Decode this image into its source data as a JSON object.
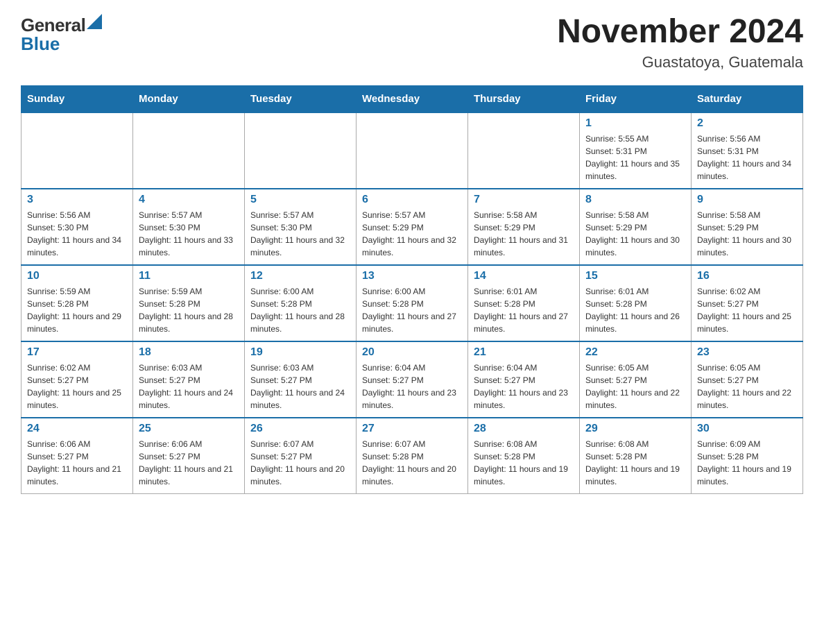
{
  "logo": {
    "general": "General",
    "blue": "Blue",
    "triangle": "▲"
  },
  "header": {
    "title": "November 2024",
    "subtitle": "Guastatoya, Guatemala"
  },
  "weekdays": [
    "Sunday",
    "Monday",
    "Tuesday",
    "Wednesday",
    "Thursday",
    "Friday",
    "Saturday"
  ],
  "weeks": [
    [
      {
        "day": "",
        "sunrise": "",
        "sunset": "",
        "daylight": ""
      },
      {
        "day": "",
        "sunrise": "",
        "sunset": "",
        "daylight": ""
      },
      {
        "day": "",
        "sunrise": "",
        "sunset": "",
        "daylight": ""
      },
      {
        "day": "",
        "sunrise": "",
        "sunset": "",
        "daylight": ""
      },
      {
        "day": "",
        "sunrise": "",
        "sunset": "",
        "daylight": ""
      },
      {
        "day": "1",
        "sunrise": "Sunrise: 5:55 AM",
        "sunset": "Sunset: 5:31 PM",
        "daylight": "Daylight: 11 hours and 35 minutes."
      },
      {
        "day": "2",
        "sunrise": "Sunrise: 5:56 AM",
        "sunset": "Sunset: 5:31 PM",
        "daylight": "Daylight: 11 hours and 34 minutes."
      }
    ],
    [
      {
        "day": "3",
        "sunrise": "Sunrise: 5:56 AM",
        "sunset": "Sunset: 5:30 PM",
        "daylight": "Daylight: 11 hours and 34 minutes."
      },
      {
        "day": "4",
        "sunrise": "Sunrise: 5:57 AM",
        "sunset": "Sunset: 5:30 PM",
        "daylight": "Daylight: 11 hours and 33 minutes."
      },
      {
        "day": "5",
        "sunrise": "Sunrise: 5:57 AM",
        "sunset": "Sunset: 5:30 PM",
        "daylight": "Daylight: 11 hours and 32 minutes."
      },
      {
        "day": "6",
        "sunrise": "Sunrise: 5:57 AM",
        "sunset": "Sunset: 5:29 PM",
        "daylight": "Daylight: 11 hours and 32 minutes."
      },
      {
        "day": "7",
        "sunrise": "Sunrise: 5:58 AM",
        "sunset": "Sunset: 5:29 PM",
        "daylight": "Daylight: 11 hours and 31 minutes."
      },
      {
        "day": "8",
        "sunrise": "Sunrise: 5:58 AM",
        "sunset": "Sunset: 5:29 PM",
        "daylight": "Daylight: 11 hours and 30 minutes."
      },
      {
        "day": "9",
        "sunrise": "Sunrise: 5:58 AM",
        "sunset": "Sunset: 5:29 PM",
        "daylight": "Daylight: 11 hours and 30 minutes."
      }
    ],
    [
      {
        "day": "10",
        "sunrise": "Sunrise: 5:59 AM",
        "sunset": "Sunset: 5:28 PM",
        "daylight": "Daylight: 11 hours and 29 minutes."
      },
      {
        "day": "11",
        "sunrise": "Sunrise: 5:59 AM",
        "sunset": "Sunset: 5:28 PM",
        "daylight": "Daylight: 11 hours and 28 minutes."
      },
      {
        "day": "12",
        "sunrise": "Sunrise: 6:00 AM",
        "sunset": "Sunset: 5:28 PM",
        "daylight": "Daylight: 11 hours and 28 minutes."
      },
      {
        "day": "13",
        "sunrise": "Sunrise: 6:00 AM",
        "sunset": "Sunset: 5:28 PM",
        "daylight": "Daylight: 11 hours and 27 minutes."
      },
      {
        "day": "14",
        "sunrise": "Sunrise: 6:01 AM",
        "sunset": "Sunset: 5:28 PM",
        "daylight": "Daylight: 11 hours and 27 minutes."
      },
      {
        "day": "15",
        "sunrise": "Sunrise: 6:01 AM",
        "sunset": "Sunset: 5:28 PM",
        "daylight": "Daylight: 11 hours and 26 minutes."
      },
      {
        "day": "16",
        "sunrise": "Sunrise: 6:02 AM",
        "sunset": "Sunset: 5:27 PM",
        "daylight": "Daylight: 11 hours and 25 minutes."
      }
    ],
    [
      {
        "day": "17",
        "sunrise": "Sunrise: 6:02 AM",
        "sunset": "Sunset: 5:27 PM",
        "daylight": "Daylight: 11 hours and 25 minutes."
      },
      {
        "day": "18",
        "sunrise": "Sunrise: 6:03 AM",
        "sunset": "Sunset: 5:27 PM",
        "daylight": "Daylight: 11 hours and 24 minutes."
      },
      {
        "day": "19",
        "sunrise": "Sunrise: 6:03 AM",
        "sunset": "Sunset: 5:27 PM",
        "daylight": "Daylight: 11 hours and 24 minutes."
      },
      {
        "day": "20",
        "sunrise": "Sunrise: 6:04 AM",
        "sunset": "Sunset: 5:27 PM",
        "daylight": "Daylight: 11 hours and 23 minutes."
      },
      {
        "day": "21",
        "sunrise": "Sunrise: 6:04 AM",
        "sunset": "Sunset: 5:27 PM",
        "daylight": "Daylight: 11 hours and 23 minutes."
      },
      {
        "day": "22",
        "sunrise": "Sunrise: 6:05 AM",
        "sunset": "Sunset: 5:27 PM",
        "daylight": "Daylight: 11 hours and 22 minutes."
      },
      {
        "day": "23",
        "sunrise": "Sunrise: 6:05 AM",
        "sunset": "Sunset: 5:27 PM",
        "daylight": "Daylight: 11 hours and 22 minutes."
      }
    ],
    [
      {
        "day": "24",
        "sunrise": "Sunrise: 6:06 AM",
        "sunset": "Sunset: 5:27 PM",
        "daylight": "Daylight: 11 hours and 21 minutes."
      },
      {
        "day": "25",
        "sunrise": "Sunrise: 6:06 AM",
        "sunset": "Sunset: 5:27 PM",
        "daylight": "Daylight: 11 hours and 21 minutes."
      },
      {
        "day": "26",
        "sunrise": "Sunrise: 6:07 AM",
        "sunset": "Sunset: 5:27 PM",
        "daylight": "Daylight: 11 hours and 20 minutes."
      },
      {
        "day": "27",
        "sunrise": "Sunrise: 6:07 AM",
        "sunset": "Sunset: 5:28 PM",
        "daylight": "Daylight: 11 hours and 20 minutes."
      },
      {
        "day": "28",
        "sunrise": "Sunrise: 6:08 AM",
        "sunset": "Sunset: 5:28 PM",
        "daylight": "Daylight: 11 hours and 19 minutes."
      },
      {
        "day": "29",
        "sunrise": "Sunrise: 6:08 AM",
        "sunset": "Sunset: 5:28 PM",
        "daylight": "Daylight: 11 hours and 19 minutes."
      },
      {
        "day": "30",
        "sunrise": "Sunrise: 6:09 AM",
        "sunset": "Sunset: 5:28 PM",
        "daylight": "Daylight: 11 hours and 19 minutes."
      }
    ]
  ]
}
